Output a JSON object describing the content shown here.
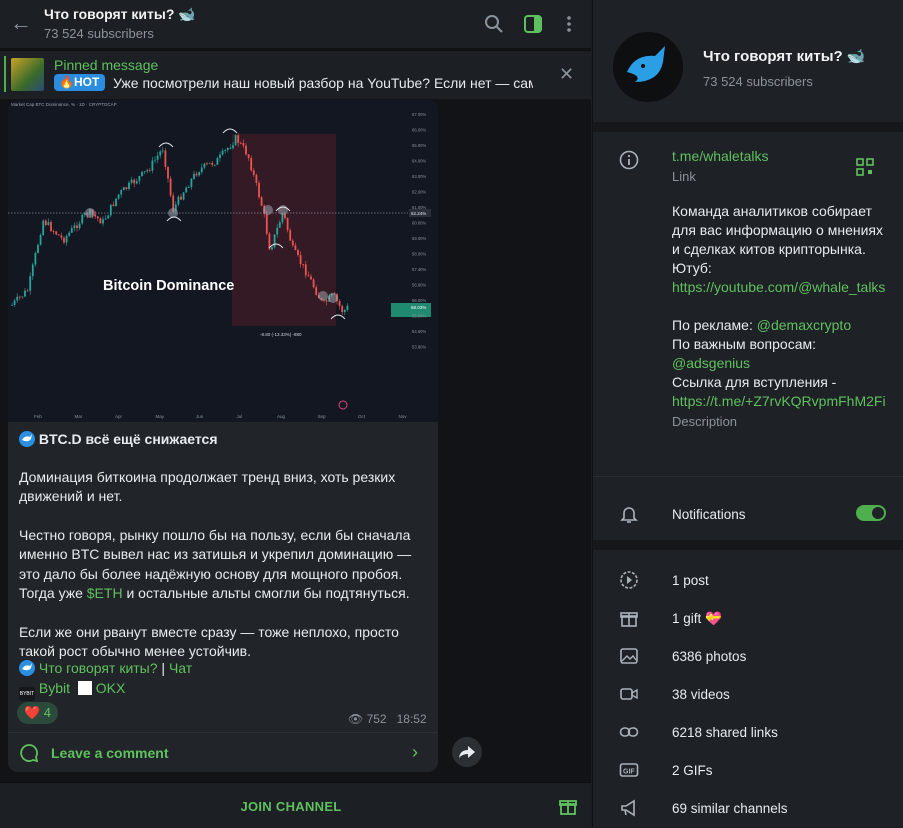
{
  "header": {
    "title": "Что говорят киты? 🐋",
    "subscribers": "73 524 subscribers"
  },
  "pinned": {
    "title": "Pinned message",
    "hot_label": "🔥HOT",
    "text": "Уже посмотрели наш новый разбор на YouTube?  Если нет — сам..."
  },
  "post": {
    "chart_caption": "Bitcoin Dominance",
    "chart_header": "Market Cap BTC Dominance, % · 1D · CRYPTOCAP",
    "chart_measure": "-8.80 (-13.33%) -880",
    "chart_price_tag": "62.24%",
    "chart_last_tag": "58.03%",
    "x_ticks": [
      "Feb",
      "Mar",
      "Apr",
      "May",
      "Jun",
      "Jul",
      "Aug",
      "Sep",
      "Oct",
      "Nov"
    ],
    "y_ticks": [
      "67.00%",
      "66.00%",
      "65.00%",
      "64.00%",
      "63.00%",
      "62.00%",
      "61.00%",
      "60.00%",
      "59.00%",
      "58.00%",
      "57.40%",
      "56.80%",
      "56.00%",
      "55.00%",
      "54.60%",
      "53.80%"
    ],
    "title": "BTC.D всё ещё снижается",
    "p1": "Доминация биткоина продолжает тренд вниз, хоть резких движений и нет.",
    "p2_a": "Честно говоря, рынку пошло бы на пользу, если бы сначала именно BTC вывел нас из затишья и укрепил доминацию — это дало бы более надёжную основу для мощного пробоя. Тогда уже ",
    "p2_eth": "$ETH",
    "p2_b": " и остальные альты смогли бы подтянуться.",
    "p3": "Если же они рванут вместе сразу — тоже неплохо, просто такой рост обычно менее устойчив.",
    "footer_channel": "Что говорят киты?",
    "footer_sep": " | ",
    "footer_chat": "Чат",
    "footer_bybit": "Bybit",
    "footer_okx": "OKX",
    "reaction": "❤️ 4",
    "views": "752",
    "time": "18:52",
    "leave_comment": "Leave a comment"
  },
  "join_label": "JOIN CHANNEL",
  "right": {
    "title": "Что говорят киты? 🐋",
    "subscribers": "73 524 subscribers",
    "link": "t.me/whaletalks",
    "link_label": "Link",
    "desc_intro": "Команда аналитиков собирает для вас информацию о мнениях и сделках китов крипторынка.",
    "desc_yt_label": "Ютуб:",
    "desc_yt_link": "https://youtube.com/@whale_talks",
    "desc_ads_label": "По рекламе: ",
    "desc_ads_handle": "@demaxcrypto",
    "desc_q_label": "По важным вопросам:",
    "desc_q_handle": "@adsgenius",
    "desc_join_label": "Ссылка для вступления -",
    "desc_join_link": "https://t.me/+Z7rvKQRvpmFhM2Fi",
    "desc_label": "Description",
    "notifications": "Notifications",
    "stats": {
      "posts": "1 post",
      "gifts": "1 gift 💝",
      "photos": "6386 photos",
      "videos": "38 videos",
      "links": "6218 shared links",
      "gifs": "2 GIFs",
      "similar": "69 similar channels"
    }
  },
  "colors": {
    "accent": "#5fc15e",
    "background": "#111316",
    "panel": "#1e2126",
    "bubble": "#212428",
    "up": "#26a69a",
    "down": "#ef5350"
  }
}
